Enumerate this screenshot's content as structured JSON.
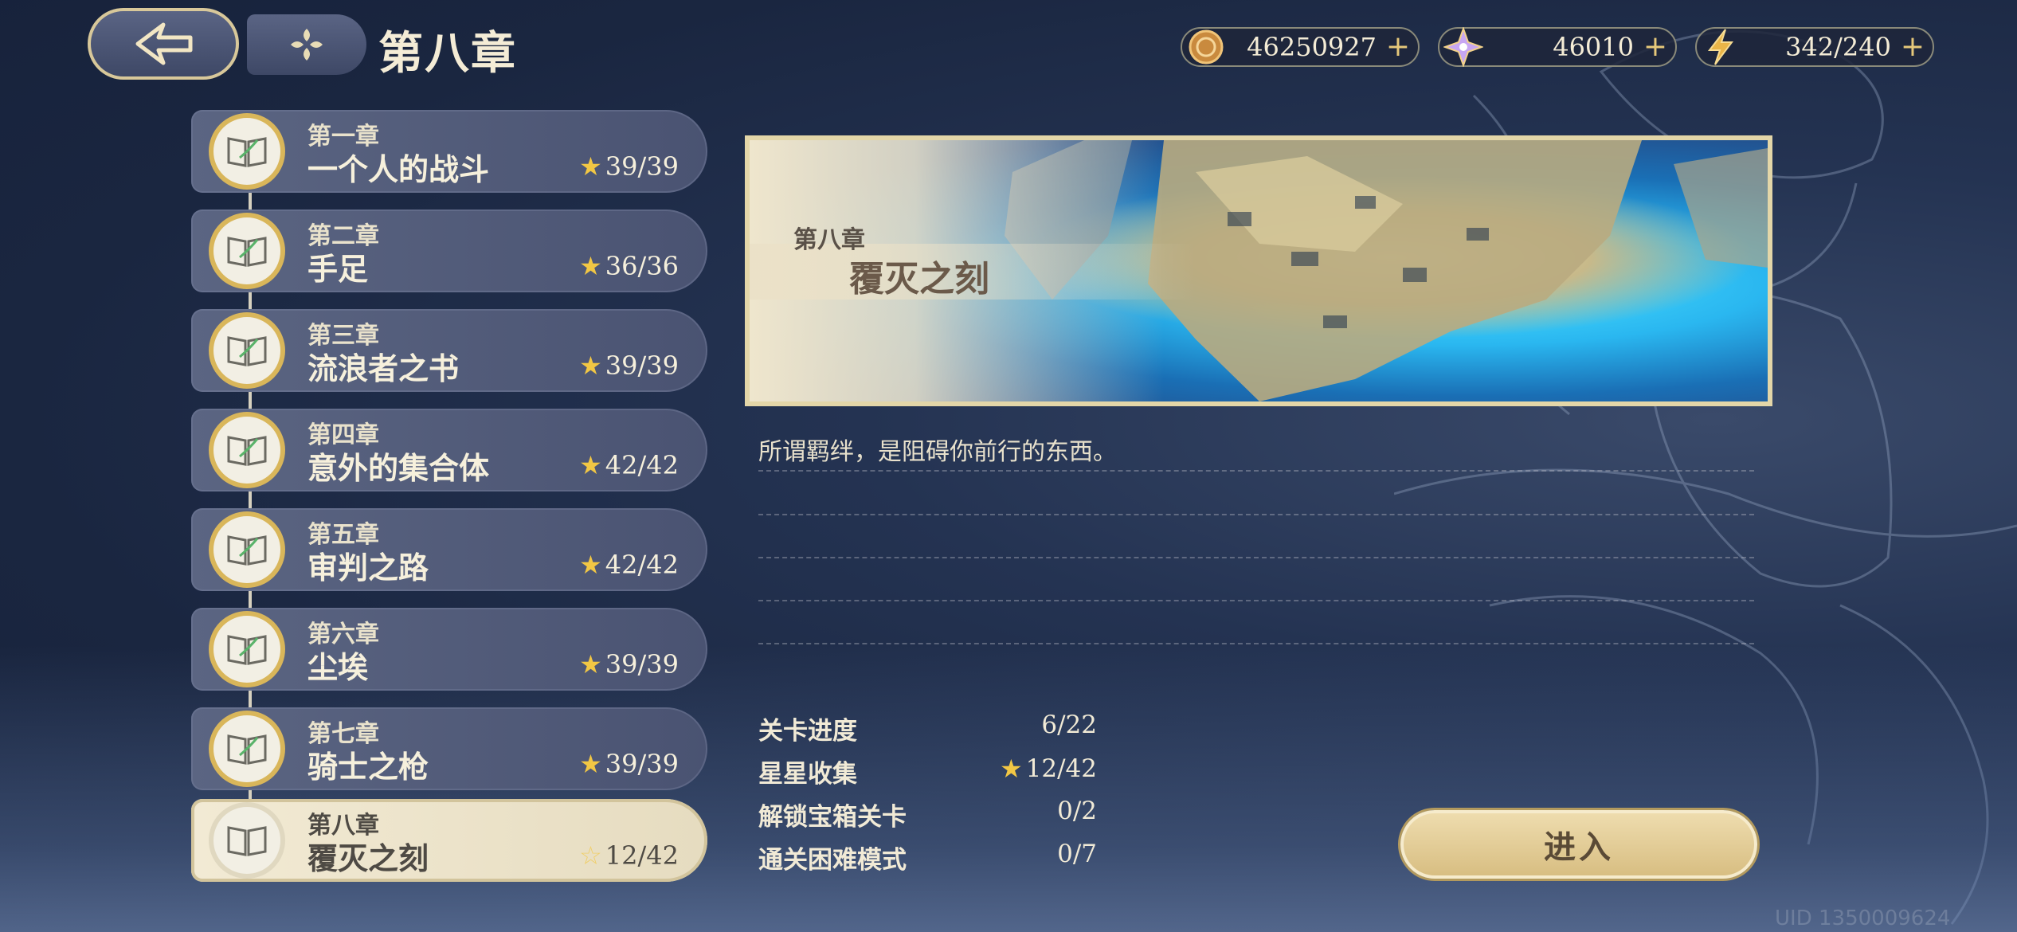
{
  "header": {
    "title": "第八章"
  },
  "resources": [
    {
      "icon": "coin-icon",
      "value": "46250927"
    },
    {
      "icon": "crystal-icon",
      "value": "46010"
    },
    {
      "icon": "stamina-bolt-icon",
      "value": "342/240"
    }
  ],
  "chapters": [
    {
      "num": "第一章",
      "name": "一个人的战斗",
      "stars": "39/39",
      "active": false
    },
    {
      "num": "第二章",
      "name": "手足",
      "stars": "36/36",
      "active": false
    },
    {
      "num": "第三章",
      "name": "流浪者之书",
      "stars": "39/39",
      "active": false
    },
    {
      "num": "第四章",
      "name": "意外的集合体",
      "stars": "42/42",
      "active": false
    },
    {
      "num": "第五章",
      "name": "审判之路",
      "stars": "42/42",
      "active": false
    },
    {
      "num": "第六章",
      "name": "尘埃",
      "stars": "39/39",
      "active": false
    },
    {
      "num": "第七章",
      "name": "骑士之枪",
      "stars": "39/39",
      "active": false
    },
    {
      "num": "第八章",
      "name": "覆灭之刻",
      "stars": "12/42",
      "active": true
    }
  ],
  "banner": {
    "num": "第八章",
    "name": "覆灭之刻"
  },
  "description": "所谓羁绊，是阻碍你前行的东西。",
  "stats": [
    {
      "label": "关卡进度",
      "value": "6/22"
    },
    {
      "label": "星星收集",
      "value": "12/42",
      "star": true
    },
    {
      "label": "解锁宝箱关卡",
      "value": "0/2"
    },
    {
      "label": "通关困难模式",
      "value": "0/7"
    }
  ],
  "enter_label": "进入",
  "uid": "UID 1350009624",
  "colors": {
    "accent_gold": "#d9b65a",
    "star": "#f2c744",
    "panel": "#4a5372"
  }
}
